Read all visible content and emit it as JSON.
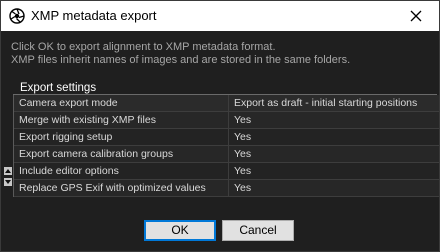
{
  "window": {
    "title": "XMP metadata export",
    "icon": "aperture-icon",
    "close_icon": "close-icon"
  },
  "message": {
    "line1": "Click OK to export alignment to XMP metadata format.",
    "line2": "XMP files inherit names of images and are stored in the same folders."
  },
  "section": {
    "title": "Export settings"
  },
  "settings": [
    {
      "label": "Camera export mode",
      "value": "Export as draft - initial starting positions"
    },
    {
      "label": "Merge with existing XMP files",
      "value": "Yes"
    },
    {
      "label": "Export rigging setup",
      "value": "Yes"
    },
    {
      "label": "Export camera calibration groups",
      "value": "Yes"
    },
    {
      "label": "Include editor options",
      "value": "Yes"
    },
    {
      "label": "Replace GPS Exif with optimized values",
      "value": "Yes"
    }
  ],
  "buttons": {
    "ok": "OK",
    "cancel": "Cancel"
  },
  "colors": {
    "titlebar_bg": "#ffffff",
    "dialog_bg": "#1f1f1f",
    "accent": "#0078d7"
  }
}
